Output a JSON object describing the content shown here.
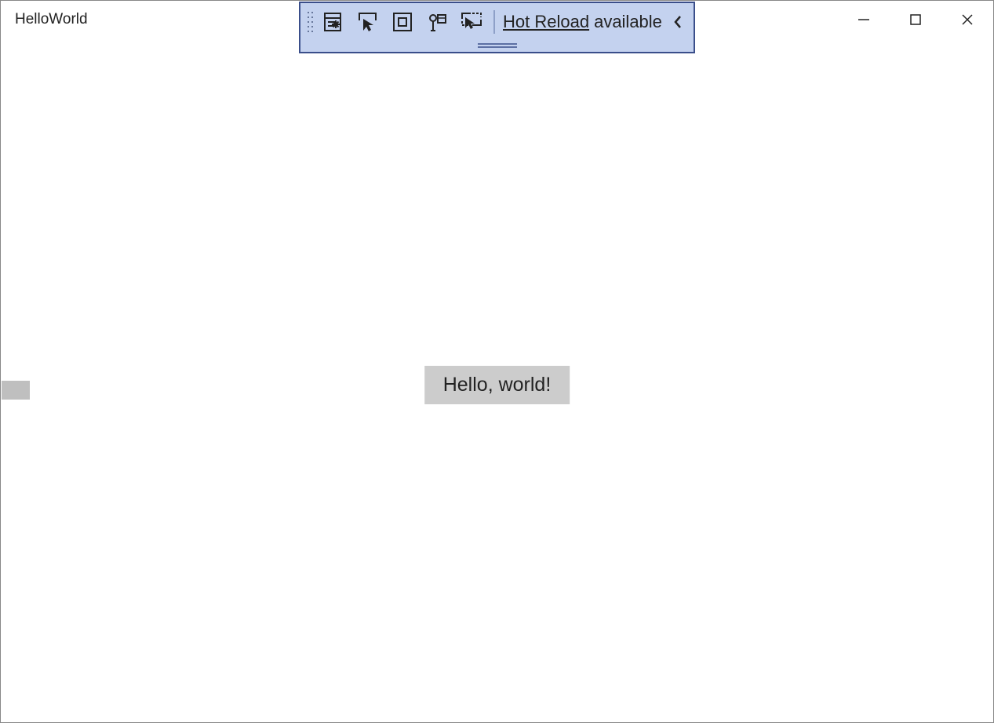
{
  "window": {
    "title": "HelloWorld"
  },
  "debug_toolbar": {
    "hot_reload_link": "Hot Reload",
    "hot_reload_suffix": " available"
  },
  "content": {
    "button_label": "Hello, world!"
  }
}
